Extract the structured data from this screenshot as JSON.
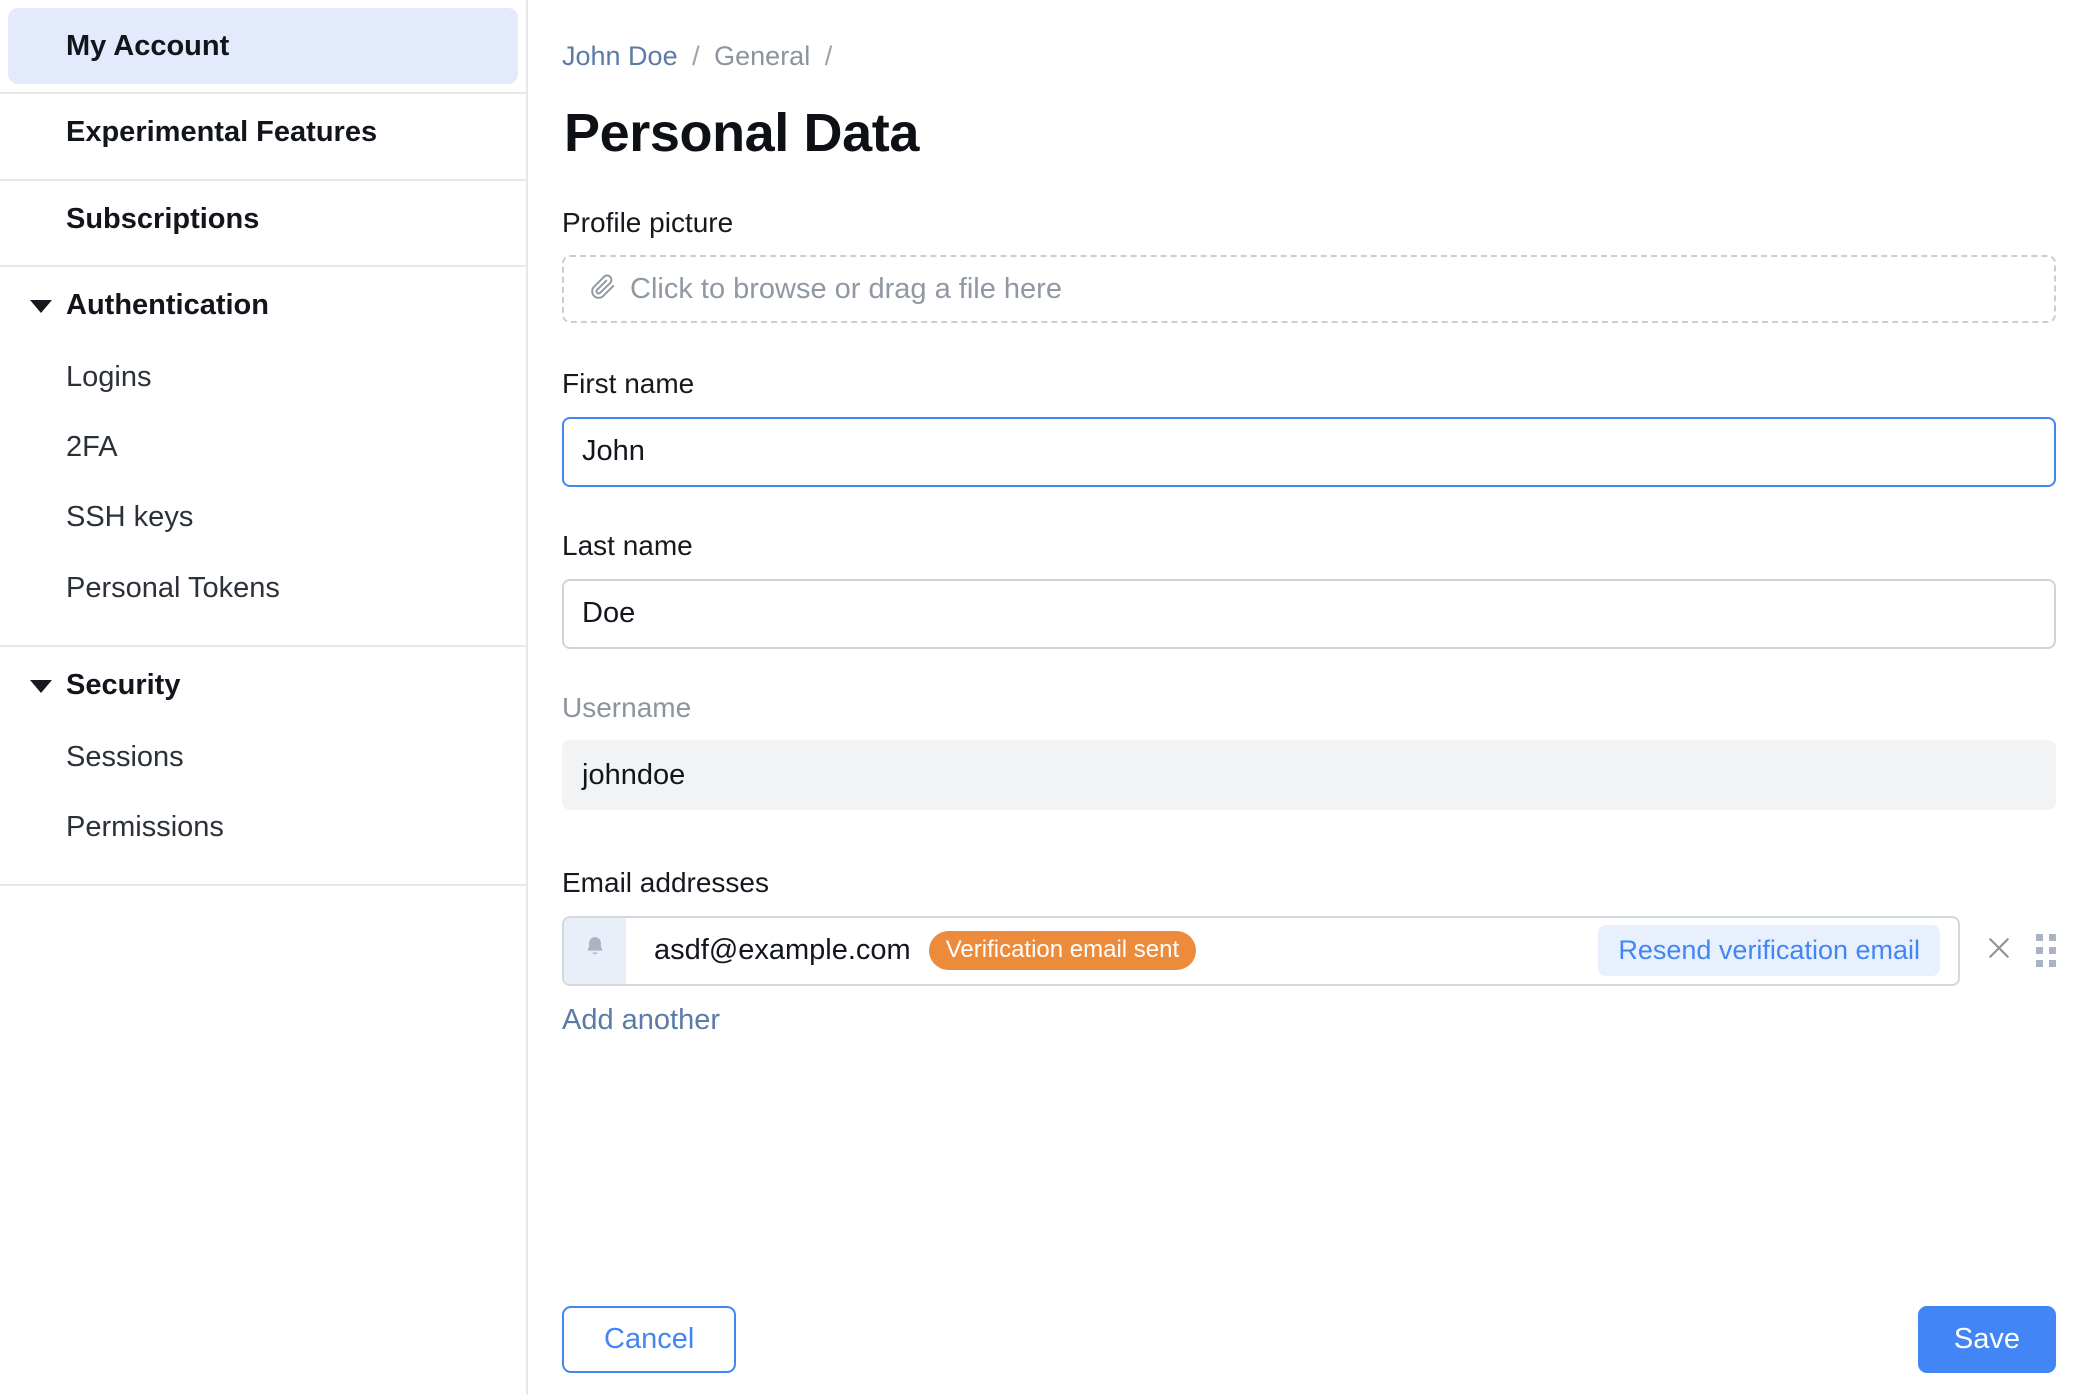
{
  "sidebar": {
    "top_items": [
      {
        "label": "My Account",
        "active": true
      },
      {
        "label": "Experimental Features",
        "active": false
      },
      {
        "label": "Subscriptions",
        "active": false
      }
    ],
    "groups": [
      {
        "label": "Authentication",
        "caret": "caret-down-icon",
        "items": [
          "Logins",
          "2FA",
          "SSH keys",
          "Personal Tokens"
        ]
      },
      {
        "label": "Security",
        "caret": "caret-down-icon",
        "items": [
          "Sessions",
          "Permissions"
        ]
      }
    ]
  },
  "breadcrumb": {
    "account": "John Doe",
    "section": "General",
    "separator": "/"
  },
  "page": {
    "title": "Personal Data"
  },
  "form": {
    "profile_picture": {
      "label": "Profile picture",
      "icon": "paperclip-icon",
      "placeholder": "Click to browse or drag a file here"
    },
    "first_name": {
      "label": "First name",
      "value": "John",
      "focused": true
    },
    "last_name": {
      "label": "Last name",
      "value": "Doe",
      "focused": false
    },
    "username": {
      "label": "Username",
      "value": "johndoe",
      "disabled": true
    },
    "emails": {
      "label": "Email addresses",
      "rows": [
        {
          "icon": "bell-icon",
          "address": "asdf@example.com",
          "badge": "Verification email sent",
          "resend_label": "Resend verification email",
          "remove_icon": "close-icon",
          "drag_icon": "drag-handle-icon"
        }
      ],
      "add_label": "Add another"
    }
  },
  "actions": {
    "cancel_label": "Cancel",
    "save_label": "Save"
  },
  "colors": {
    "accent": "#4285f4",
    "badge_orange": "#ec8b3c",
    "active_nav_bg": "#e3eafc",
    "link_muted": "#5b7ba6"
  }
}
